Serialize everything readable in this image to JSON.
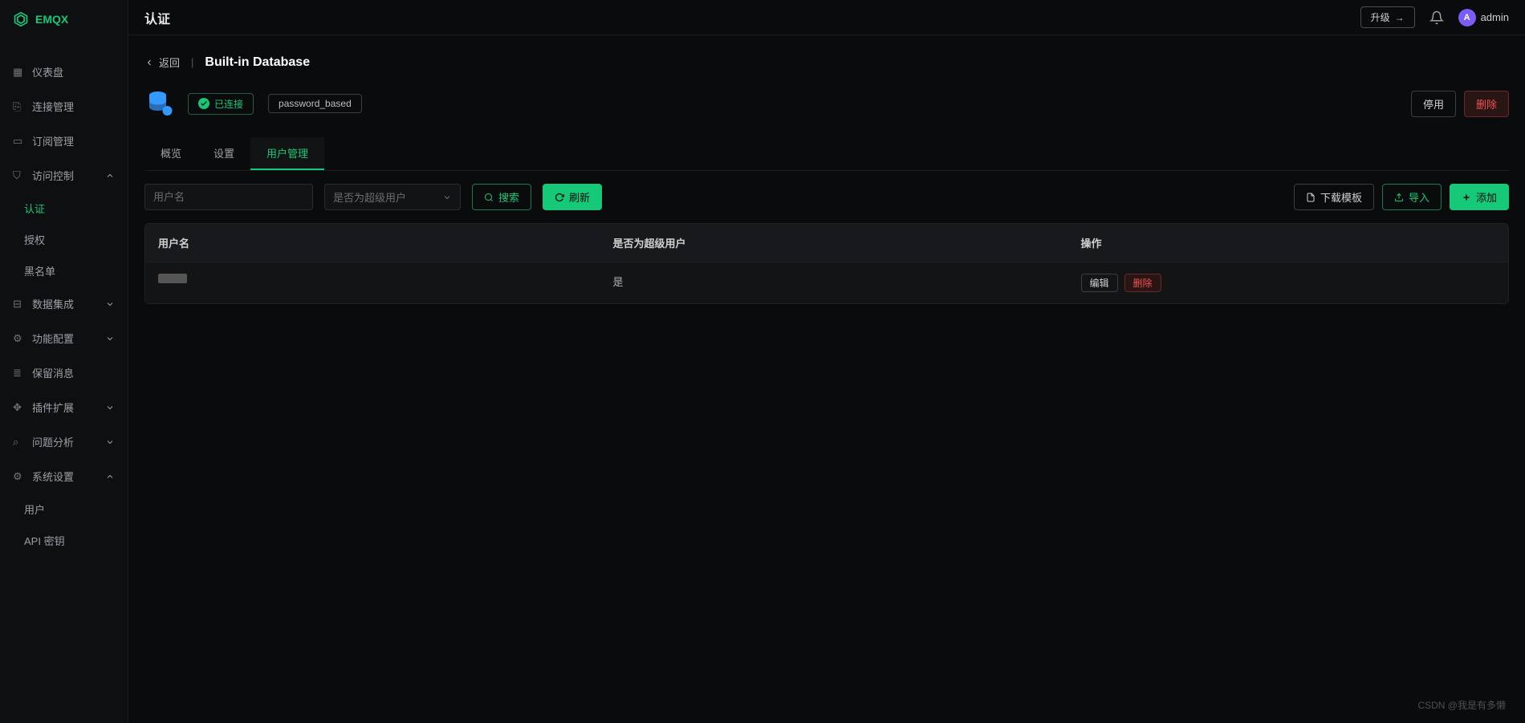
{
  "brand": {
    "name": "EMQX"
  },
  "topbar": {
    "title": "认证",
    "upgrade": "升级",
    "user": "admin",
    "avatar_letter": "A"
  },
  "sidebar": {
    "dashboard": "仪表盘",
    "conn_mgmt": "连接管理",
    "sub_mgmt": "订阅管理",
    "access_control": "访问控制",
    "auth": "认证",
    "authz": "授权",
    "blacklist": "黑名单",
    "data_integration": "数据集成",
    "feature_config": "功能配置",
    "retained_msg": "保留消息",
    "plugin_ext": "插件扩展",
    "problem_analysis": "问题分析",
    "system_settings": "系统设置",
    "users": "用户",
    "api_keys": "API 密钥"
  },
  "breadcrumb": {
    "back": "返回",
    "title": "Built-in Database"
  },
  "status": {
    "connected": "已连接",
    "auth_type": "password_based"
  },
  "actions": {
    "disable": "停用",
    "delete": "删除"
  },
  "tabs": {
    "overview": "概览",
    "settings": "设置",
    "user_mgmt": "用户管理"
  },
  "filters": {
    "username_placeholder": "用户名",
    "superuser_placeholder": "是否为超级用户",
    "search": "搜索",
    "refresh": "刷新",
    "download_template": "下载模板",
    "import": "导入",
    "add": "添加"
  },
  "table": {
    "col_user": "用户名",
    "col_super": "是否为超级用户",
    "col_ops": "操作",
    "rows": [
      {
        "username_masked": true,
        "is_super": "是"
      }
    ],
    "edit": "编辑",
    "delete": "删除"
  },
  "watermark": "CSDN @我是有多懒"
}
